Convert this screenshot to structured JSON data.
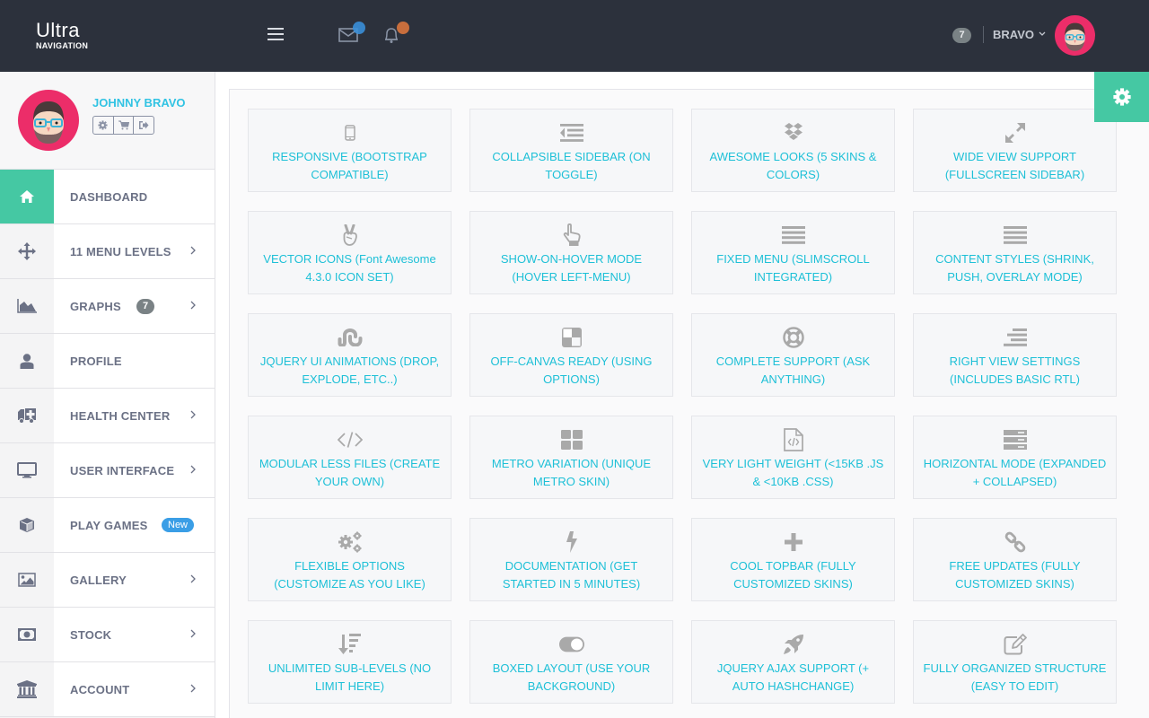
{
  "brand": {
    "title": "Ultra",
    "subtitle": "NAVIGATION"
  },
  "topbar": {
    "menu_toggle_icon": "hamburger-icon",
    "mail_icon": "envelope-icon",
    "mail_dot_color": "#3a8fd8",
    "bell_icon": "bell-icon",
    "bell_dot_color": "#d9763d",
    "count_badge": "7",
    "user_label": "BRAVO",
    "user_caret": "chevron-down-icon"
  },
  "profile": {
    "name": "JOHNNY BRAVO",
    "actions": [
      "gear-icon",
      "cart-icon",
      "sign-out-icon"
    ]
  },
  "sidebar": {
    "items": [
      {
        "label": "DASHBOARD",
        "icon": "home-icon",
        "active": true,
        "chevron": false
      },
      {
        "label": "11 MENU LEVELS",
        "icon": "arrows-icon",
        "chevron": true
      },
      {
        "label": "GRAPHS",
        "icon": "area-chart-icon",
        "badge": "7",
        "chevron": true
      },
      {
        "label": "PROFILE",
        "icon": "user-icon",
        "chevron": false
      },
      {
        "label": "HEALTH CENTER",
        "icon": "ambulance-icon",
        "chevron": true
      },
      {
        "label": "USER INTERFACE",
        "icon": "desktop-icon",
        "chevron": true
      },
      {
        "label": "PLAY GAMES",
        "icon": "cube-icon",
        "badge_new": "New",
        "chevron": false
      },
      {
        "label": "GALLERY",
        "icon": "image-icon",
        "chevron": true
      },
      {
        "label": "STOCK",
        "icon": "money-icon",
        "chevron": true
      },
      {
        "label": "ACCOUNT",
        "icon": "bank-icon",
        "chevron": true
      }
    ]
  },
  "settings_button": {
    "icon": "gear-icon"
  },
  "features": [
    {
      "icon": "mobile-icon",
      "label": "RESPONSIVE (BOOTSTRAP COMPATIBLE)"
    },
    {
      "icon": "outdent-icon",
      "label": "COLLAPSIBLE SIDEBAR (ON TOGGLE)"
    },
    {
      "icon": "dropbox-icon",
      "label": "AWESOME LOOKS (5 SKINS & COLORS)"
    },
    {
      "icon": "expand-icon",
      "label": "WIDE VIEW SUPPORT (FULLSCREEN SIDEBAR)"
    },
    {
      "icon": "hand-peace-icon",
      "label": "VECTOR ICONS (Font Awesome 4.3.0 ICON SET)"
    },
    {
      "icon": "hand-pointer-icon",
      "label": "SHOW-ON-HOVER MODE (HOVER LEFT-MENU)"
    },
    {
      "icon": "bars-icon",
      "label": "FIXED MENU (SLIMSCROLL INTEGRATED)"
    },
    {
      "icon": "bars-icon",
      "label": "CONTENT STYLES (SHRINK, PUSH, OVERLAY MODE)"
    },
    {
      "icon": "stumbleupon-icon",
      "label": "JQUERY UI ANIMATIONS (DROP, EXPLODE, ETC..)"
    },
    {
      "icon": "delicious-icon",
      "label": "OFF-CANVAS READY (USING OPTIONS)"
    },
    {
      "icon": "life-ring-icon",
      "label": "COMPLETE SUPPORT (ASK ANYTHING)"
    },
    {
      "icon": "align-right-icon",
      "label": "RIGHT VIEW SETTINGS (INCLUDES BASIC RTL)"
    },
    {
      "icon": "code-icon",
      "label": "MODULAR LESS FILES (CREATE YOUR OWN)"
    },
    {
      "icon": "th-large-icon",
      "label": "METRO VARIATION (UNIQUE METRO SKIN)"
    },
    {
      "icon": "file-code-icon",
      "label": "VERY LIGHT WEIGHT (<15KB .JS & <10KB .CSS)"
    },
    {
      "icon": "server-icon",
      "label": "HORIZONTAL MODE (EXPANDED + COLLAPSED)"
    },
    {
      "icon": "cogs-icon",
      "label": "FLEXIBLE OPTIONS (CUSTOMIZE AS YOU LIKE)"
    },
    {
      "icon": "bolt-icon",
      "label": "DOCUMENTATION (GET STARTED IN 5 MINUTES)"
    },
    {
      "icon": "plus-icon",
      "label": "COOL TOPBAR (FULLY CUSTOMIZED SKINS)"
    },
    {
      "icon": "chain-icon",
      "label": "FREE UPDATES (FULLY CUSTOMIZED SKINS)"
    },
    {
      "icon": "sort-amount-desc-icon",
      "label": "UNLIMITED SUB-LEVELS (NO LIMIT HERE)"
    },
    {
      "icon": "toggle-on-icon",
      "label": "BOXED LAYOUT (USE YOUR BACKGROUND)"
    },
    {
      "icon": "rocket-icon",
      "label": "JQUERY AJAX SUPPORT (+ AUTO HASHCHANGE)"
    },
    {
      "icon": "edit-icon",
      "label": "FULLY ORGANIZED STRUCTURE (EASY TO EDIT)"
    }
  ],
  "colors": {
    "topbar_bg": "#2c313c",
    "accent_green": "#45c8a3",
    "feature_text": "#1ec0d7",
    "profile_name": "#31c3e3",
    "nav_text": "#6b7185",
    "icon_gray": "#a9a9a9",
    "avatar_pink": "#ec2d69",
    "badge_blue": "#3a9ee6"
  }
}
